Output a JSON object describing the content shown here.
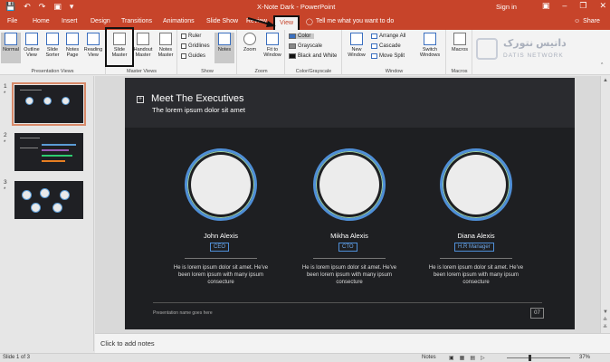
{
  "titlebar": {
    "title": "X-Note Dark - PowerPoint",
    "signin": "Sign in",
    "qat": [
      "save-icon",
      "undo-icon",
      "redo-icon",
      "present-icon",
      "customize-icon"
    ],
    "window_buttons": [
      "–",
      "❐",
      "✕"
    ]
  },
  "tabs": [
    "File",
    "Home",
    "Insert",
    "Design",
    "Transitions",
    "Animations",
    "Slide Show",
    "Review",
    "View"
  ],
  "active_tab": "View",
  "tellme": "Tell me what you want to do",
  "share": "Share",
  "ribbon": {
    "presentation_views": {
      "label": "Presentation Views",
      "buttons": [
        "Normal",
        "Outline View",
        "Slide Sorter",
        "Notes Page",
        "Reading View"
      ]
    },
    "master_views": {
      "label": "Master Views",
      "buttons": [
        "Slide Master",
        "Handout Master",
        "Notes Master"
      ]
    },
    "show": {
      "label": "Show",
      "checks": [
        "Ruler",
        "Gridlines",
        "Guides"
      ]
    },
    "notes_btn": "Notes",
    "zoom": {
      "label": "Zoom",
      "buttons": [
        "Zoom",
        "Fit to Window"
      ]
    },
    "color": {
      "label": "Color/Grayscale",
      "options": [
        "Color",
        "Grayscale",
        "Black and White"
      ]
    },
    "window": {
      "label": "Window",
      "new_window": "New Window",
      "options": [
        "Arrange All",
        "Cascade",
        "Move Split"
      ],
      "switch": "Switch Windows"
    },
    "macros": {
      "label": "Macros",
      "button": "Macros"
    }
  },
  "watermark": {
    "arabic": "داتیس نتورک",
    "english": "DATIS NETWORK"
  },
  "thumbnails": [
    {
      "num": "1",
      "star": "*"
    },
    {
      "num": "2",
      "star": "*"
    },
    {
      "num": "3",
      "star": "*"
    }
  ],
  "slide": {
    "title": "Meet The Executives",
    "subtitle": "The lorem ipsum dolor sit amet",
    "people": [
      {
        "name": "John Alexis",
        "role": "CEO",
        "desc": "He is lorem ipsum dolor sit amet. He've been lorem ipsum with many ipsum consecture"
      },
      {
        "name": "Mikha Alexis",
        "role": "CTO",
        "desc": "He is lorem ipsum dolor sit amet. He've been lorem ipsum with many ipsum consecture"
      },
      {
        "name": "Diana Alexis",
        "role": "H.R Manager",
        "desc": "He is lorem ipsum dolor sit amet. He've been lorem ipsum with many ipsum consecture"
      }
    ],
    "footer": "Presentation name goes here",
    "page": "07"
  },
  "notes_placeholder": "Click to add notes",
  "status": {
    "slide": "Slide 1 of 3",
    "notes": "Notes",
    "zoom": "37%"
  },
  "colors": {
    "accent": "#c7442a",
    "slide_bg": "#1e1f22",
    "ring": "#4f8fd8"
  }
}
